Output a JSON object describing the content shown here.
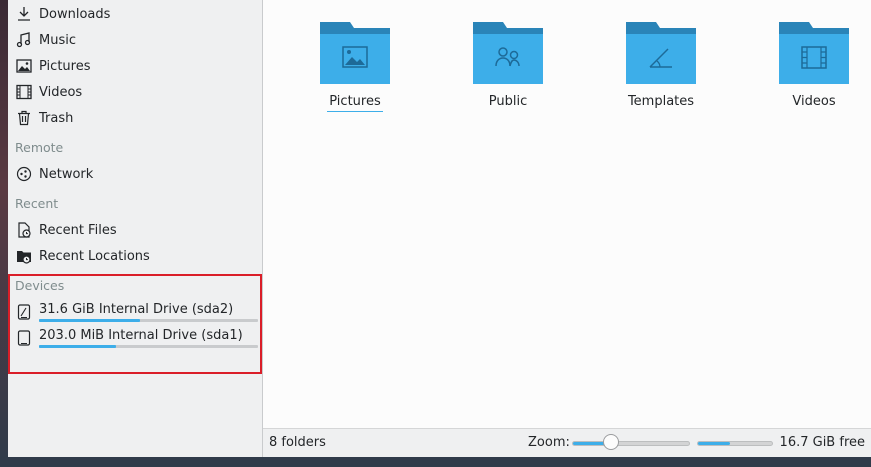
{
  "sidebar": {
    "places": [
      {
        "label": "Downloads",
        "icon": "download-icon"
      },
      {
        "label": "Music",
        "icon": "music-icon"
      },
      {
        "label": "Pictures",
        "icon": "pictures-icon"
      },
      {
        "label": "Videos",
        "icon": "videos-icon"
      },
      {
        "label": "Trash",
        "icon": "trash-icon"
      }
    ],
    "remote_header": "Remote",
    "remote": [
      {
        "label": "Network",
        "icon": "network-icon"
      }
    ],
    "recent_header": "Recent",
    "recent": [
      {
        "label": "Recent Files",
        "icon": "recent-files-icon"
      },
      {
        "label": "Recent Locations",
        "icon": "recent-locations-icon"
      }
    ],
    "devices_header": "Devices",
    "devices": [
      {
        "label": "31.6 GiB Internal Drive (sda2)",
        "icon": "drive-icon",
        "used_fraction": 0.46
      },
      {
        "label": "203.0 MiB Internal Drive (sda1)",
        "icon": "drive-icon",
        "used_fraction": 0.35
      }
    ]
  },
  "main": {
    "folders": [
      {
        "name": "Pictures",
        "icon": "pictures-folder-icon",
        "selected": true
      },
      {
        "name": "Public",
        "icon": "public-folder-icon",
        "selected": false
      },
      {
        "name": "Templates",
        "icon": "templates-folder-icon",
        "selected": false
      },
      {
        "name": "Videos",
        "icon": "videos-folder-icon",
        "selected": false
      }
    ]
  },
  "status": {
    "folder_count": "8 folders",
    "zoom_label": "Zoom:",
    "zoom_fraction": 0.33,
    "free_space_fraction": 0.43,
    "free_text": "16.7 GiB free"
  },
  "colors": {
    "accent": "#3daee9",
    "folder_body": "#3daee9",
    "folder_tab": "#2a84b8",
    "highlight": "#da1e28"
  }
}
